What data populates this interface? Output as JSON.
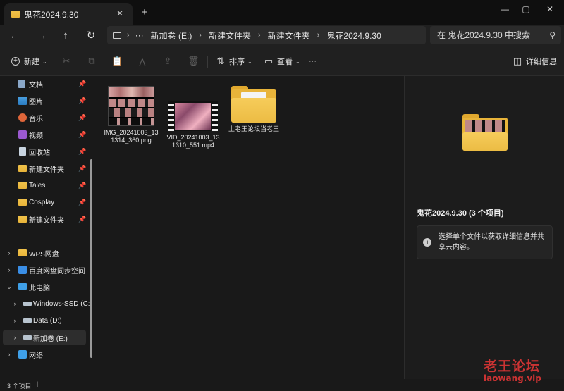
{
  "tab": {
    "title": "鬼花2024.9.30",
    "close_icon": "close-icon",
    "new_tab_icon": "plus-icon"
  },
  "window": {
    "min_icon": "minimize-icon",
    "max_icon": "maximize-icon",
    "close_icon": "close-icon"
  },
  "nav": {
    "back_icon": "arrow-left-icon",
    "forward_icon": "arrow-right-icon",
    "up_icon": "arrow-up-icon",
    "refresh_icon": "refresh-icon",
    "breadcrumb": [
      "新加卷 (E:)",
      "新建文件夹",
      "新建文件夹",
      "鬼花2024.9.30"
    ],
    "more": "···",
    "search_placeholder": "在 鬼花2024.9.30 中搜索"
  },
  "toolbar": {
    "new_label": "新建",
    "sort_label": "排序",
    "view_label": "查看",
    "more_label": "···",
    "details_label": "详细信息"
  },
  "sidebar": {
    "quick": [
      {
        "label": "文档",
        "icon": "document-icon"
      },
      {
        "label": "图片",
        "icon": "picture-icon"
      },
      {
        "label": "音乐",
        "icon": "music-icon"
      },
      {
        "label": "视频",
        "icon": "video-icon"
      },
      {
        "label": "回收站",
        "icon": "recycle-bin-icon"
      },
      {
        "label": "新建文件夹",
        "icon": "folder-icon"
      },
      {
        "label": "Tales",
        "icon": "folder-icon"
      },
      {
        "label": "Cosplay",
        "icon": "folder-icon"
      },
      {
        "label": "新建文件夹",
        "icon": "folder-icon"
      }
    ],
    "places": [
      {
        "label": "WPS网盘",
        "icon": "folder-icon"
      },
      {
        "label": "百度网盘同步空间",
        "icon": "cloud-icon"
      },
      {
        "label": "此电脑",
        "icon": "computer-icon"
      },
      {
        "label": "Windows-SSD (C:",
        "icon": "drive-icon"
      },
      {
        "label": "Data (D:)",
        "icon": "drive-icon"
      },
      {
        "label": "新加卷 (E:)",
        "icon": "drive-icon"
      },
      {
        "label": "网络",
        "icon": "network-icon"
      }
    ]
  },
  "files": [
    {
      "name": "IMG_20241003_131314_360.png",
      "type": "image"
    },
    {
      "name": "VID_20241003_131310_551.mp4",
      "type": "video"
    },
    {
      "name": "上老王论坛当老王",
      "type": "folder"
    }
  ],
  "details": {
    "title": "鬼花2024.9.30 (3 个项目)",
    "info": "选择单个文件以获取详细信息并共享云内容。"
  },
  "status": {
    "count": "3 个项目",
    "separator": "|"
  },
  "watermark": {
    "line1": "老王论坛",
    "line2": "laowang.vip"
  },
  "colors": {
    "folder": "#f0c24a",
    "background": "#191919",
    "panel": "#202020",
    "watermark": "#cc3333"
  }
}
